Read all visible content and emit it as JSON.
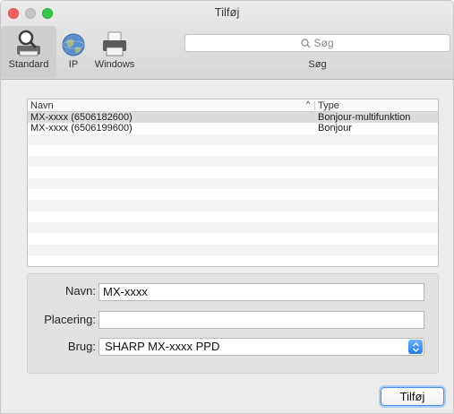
{
  "window": {
    "title": "Tilføj"
  },
  "toolbar": {
    "standard_label": "Standard",
    "ip_label": "IP",
    "windows_label": "Windows",
    "search_placeholder": "Søg",
    "search_label": "Søg"
  },
  "list": {
    "headers": {
      "name": "Navn",
      "type": "Type",
      "sort_indicator": "^"
    },
    "rows": [
      {
        "name": "MX-xxxx (6506182600)",
        "type": "Bonjour-multifunktion"
      },
      {
        "name": "MX-xxxx (6506199600)",
        "type": "Bonjour"
      }
    ]
  },
  "form": {
    "name_label": "Navn:",
    "name_value": "MX-xxxx",
    "location_label": "Placering:",
    "location_value": "",
    "use_label": "Brug:",
    "use_value": "SHARP MX-xxxx PPD"
  },
  "buttons": {
    "add_label": "Tilføj"
  },
  "colors": {
    "accent": "#1f7cf3",
    "close": "#fc605c",
    "zoom": "#34c84a",
    "min_inactive": "#c6c6c6"
  }
}
